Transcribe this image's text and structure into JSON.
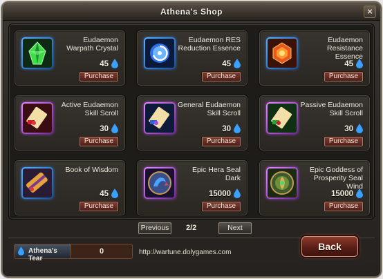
{
  "window": {
    "title": "Athena's Shop"
  },
  "items": [
    {
      "name": "Eudaemon Warpath Crystal",
      "price": "45",
      "button": "Purchase",
      "icon": "green-crystal-icon",
      "frame": "blue"
    },
    {
      "name": "Eudaemon RES Reduction Essence",
      "price": "45",
      "button": "Purchase",
      "icon": "blue-swirl-essence-icon",
      "frame": "blue"
    },
    {
      "name": "Eudaemon Resistance Essence",
      "price": "45",
      "button": "Purchase",
      "icon": "red-flame-essence-icon",
      "frame": "blue"
    },
    {
      "name": "Active Eudaemon Skill Scroll",
      "price": "30",
      "button": "Purchase",
      "icon": "red-scroll-icon",
      "frame": "purple"
    },
    {
      "name": "General Eudaemon Skill Scroll",
      "price": "30",
      "button": "Purchase",
      "icon": "blue-scroll-icon",
      "frame": "purple"
    },
    {
      "name": "Passive Eudaemon Skill Scroll",
      "price": "30",
      "button": "Purchase",
      "icon": "green-scroll-icon",
      "frame": "purple"
    },
    {
      "name": "Book of Wisdom",
      "price": "45",
      "button": "Purchase",
      "icon": "book-scroll-icon",
      "frame": "blue"
    },
    {
      "name": "Epic Hera Seal Dark",
      "price": "15000",
      "button": "Purchase",
      "icon": "dark-seal-icon",
      "frame": "purple"
    },
    {
      "name": "Epic Goddess of Prosperity Seal Wind",
      "price": "15000",
      "button": "Purchase",
      "icon": "wind-seal-icon",
      "frame": "purple"
    }
  ],
  "pagination": {
    "previous": "Previous",
    "next": "Next",
    "page": "2/2"
  },
  "footer": {
    "currency_label": "Athena's Tear",
    "currency_count": "0",
    "url": "http://wartune.dolygames.com",
    "back": "Back"
  },
  "colors": {
    "accent": "#7c3b30",
    "currency": "#3aa0ff"
  }
}
